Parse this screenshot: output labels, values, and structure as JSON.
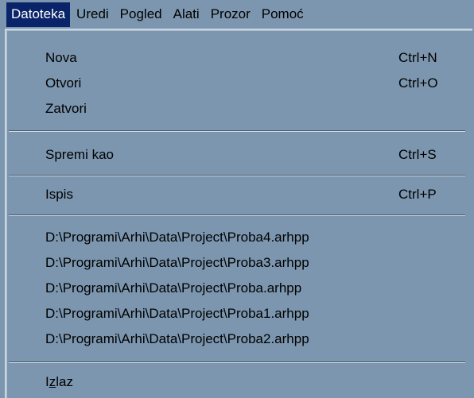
{
  "menubar": {
    "items": [
      {
        "label": "Datoteka",
        "active": true
      },
      {
        "label": "Uredi"
      },
      {
        "label": "Pogled"
      },
      {
        "label": "Alati"
      },
      {
        "label": "Prozor"
      },
      {
        "label": "Pomoć"
      }
    ]
  },
  "menu": {
    "new": {
      "label": "Nova",
      "shortcut": "Ctrl+N"
    },
    "open": {
      "label": "Otvori",
      "shortcut": "Ctrl+O"
    },
    "close": {
      "label": "Zatvori"
    },
    "save_as": {
      "label": "Spremi kao",
      "shortcut": "Ctrl+S"
    },
    "print": {
      "label": "Ispis",
      "shortcut": "Ctrl+P"
    },
    "recent_files": [
      "D:\\Programi\\Arhi\\Data\\Project\\Proba4.arhpp",
      "D:\\Programi\\Arhi\\Data\\Project\\Proba3.arhpp",
      "D:\\Programi\\Arhi\\Data\\Project\\Proba.arhpp",
      "D:\\Programi\\Arhi\\Data\\Project\\Proba1.arhpp",
      "D:\\Programi\\Arhi\\Data\\Project\\Proba2.arhpp"
    ],
    "exit": {
      "label_prefix": "I",
      "label_mnemonic": "z",
      "label_suffix": "laz"
    }
  },
  "colors": {
    "background": "#7b96ae",
    "highlight": "#0a246a",
    "highlight_text": "#ffffff"
  }
}
